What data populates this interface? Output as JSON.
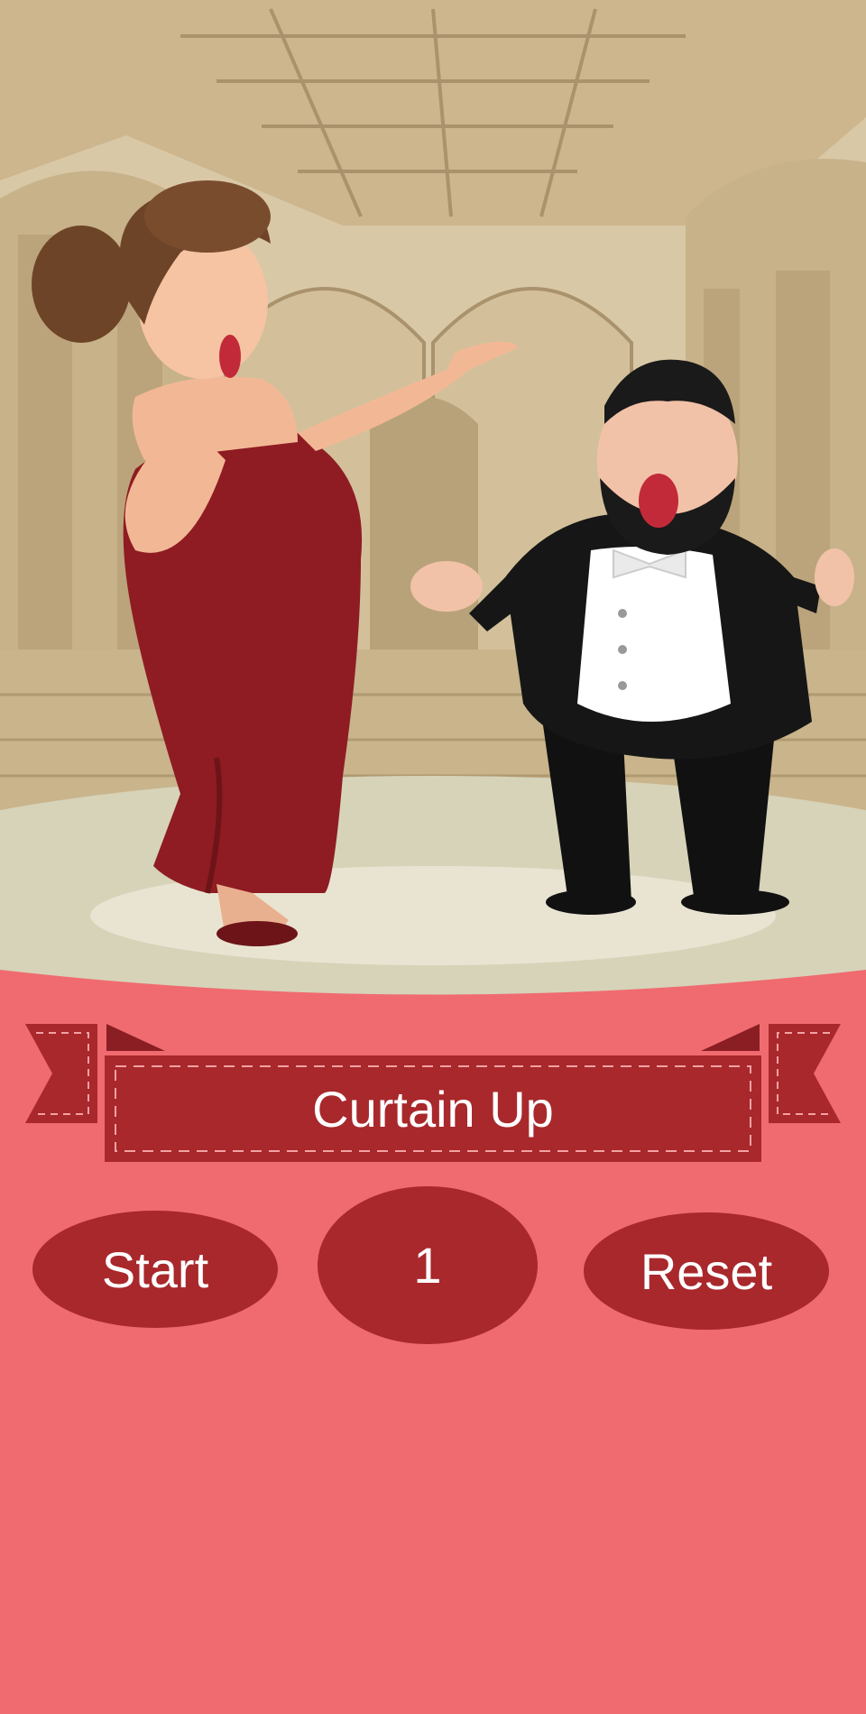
{
  "banner": {
    "title": "Curtain Up"
  },
  "controls": {
    "start_label": "Start",
    "counter_value": "1",
    "reset_label": "Reset"
  },
  "icons": {
    "scene": "opera-stage-illustration",
    "soprano": "soprano-singer-illustration",
    "tenor": "tenor-singer-illustration"
  },
  "colors": {
    "background": "#f06b70",
    "button": "#a8282c",
    "banner": "#a8282c",
    "text": "#ffffff"
  }
}
